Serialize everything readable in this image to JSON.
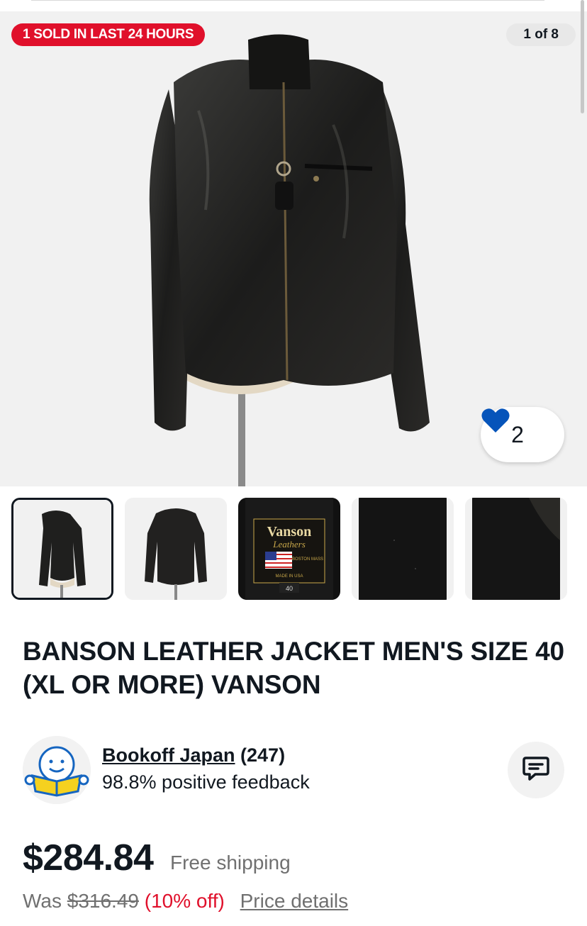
{
  "hero": {
    "badge": "1 SOLD IN LAST 24 HOURS",
    "counter": "1 of 8",
    "watchers": "2"
  },
  "thumbnails": [
    {
      "name": "thumb-1-front",
      "selected": true
    },
    {
      "name": "thumb-2-back",
      "selected": false
    },
    {
      "name": "thumb-3-label",
      "selected": false,
      "label_brand": "Vanson",
      "label_line2": "Leathers",
      "label_city": "BOSTON MASS",
      "label_made": "MADE IN USA",
      "label_size": "40"
    },
    {
      "name": "thumb-4-lining",
      "selected": false
    },
    {
      "name": "thumb-5-detail",
      "selected": false
    }
  ],
  "listing": {
    "title": "BANSON LEATHER JACKET MEN'S SIZE 40 (XL OR MORE) VANSON"
  },
  "seller": {
    "name": "Bookoff Japan",
    "count": "(247)",
    "feedback": "98.8% positive feedback"
  },
  "pricing": {
    "price": "$284.84",
    "shipping": "Free shipping",
    "was_label": "Was",
    "was_price": "$316.49",
    "discount": "(10% off)",
    "details_link": "Price details"
  },
  "colors": {
    "badge_red": "#e0102b",
    "heart_blue": "#0654ba",
    "text": "#111820",
    "muted": "#707070"
  },
  "icons": [
    "heart-icon",
    "message-icon"
  ]
}
